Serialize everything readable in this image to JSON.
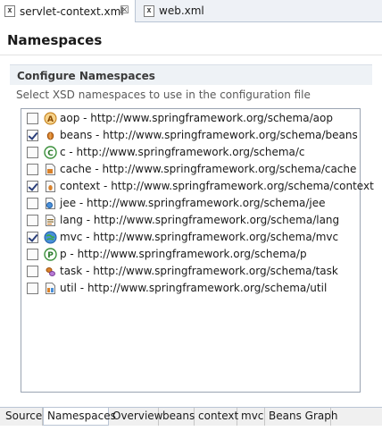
{
  "editor_tabs": [
    {
      "label": "servlet-context.xml",
      "active": true
    },
    {
      "label": "web.xml",
      "active": false
    }
  ],
  "page": {
    "title": "Namespaces"
  },
  "section": {
    "title": "Configure Namespaces",
    "description": "Select XSD namespaces to use in the configuration file"
  },
  "namespaces": [
    {
      "label": "aop - http://www.springframework.org/schema/aop",
      "checked": false,
      "icon": "aop-icon"
    },
    {
      "label": "beans - http://www.springframework.org/schema/beans",
      "checked": true,
      "icon": "beans-icon"
    },
    {
      "label": "c - http://www.springframework.org/schema/c",
      "checked": false,
      "icon": "c-namespace-icon"
    },
    {
      "label": "cache - http://www.springframework.org/schema/cache",
      "checked": false,
      "icon": "cache-icon"
    },
    {
      "label": "context - http://www.springframework.org/schema/context",
      "checked": true,
      "icon": "context-icon"
    },
    {
      "label": "jee - http://www.springframework.org/schema/jee",
      "checked": false,
      "icon": "jee-icon"
    },
    {
      "label": "lang - http://www.springframework.org/schema/lang",
      "checked": false,
      "icon": "lang-icon"
    },
    {
      "label": "mvc - http://www.springframework.org/schema/mvc",
      "checked": true,
      "icon": "mvc-icon"
    },
    {
      "label": "p - http://www.springframework.org/schema/p",
      "checked": false,
      "icon": "p-namespace-icon"
    },
    {
      "label": "task - http://www.springframework.org/schema/task",
      "checked": false,
      "icon": "task-icon"
    },
    {
      "label": "util - http://www.springframework.org/schema/util",
      "checked": false,
      "icon": "util-icon"
    }
  ],
  "bottom_tabs": [
    {
      "label": "Source",
      "active": false
    },
    {
      "label": "Namespaces",
      "active": true
    },
    {
      "label": "Overview",
      "active": false
    },
    {
      "label": "beans",
      "active": false
    },
    {
      "label": "context",
      "active": false
    },
    {
      "label": "mvc",
      "active": false
    },
    {
      "label": "Beans Graph",
      "active": false
    }
  ]
}
